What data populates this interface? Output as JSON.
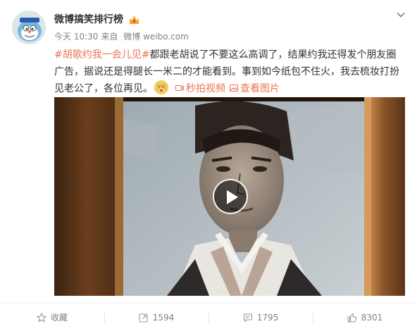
{
  "post": {
    "username": "微博搞笑排行榜",
    "time": "今天 10:30",
    "source_prefix": "来自",
    "source": "微博 weibo.com",
    "hashtag": "#胡歌约我一会儿见#",
    "text": "都跟老胡说了不要这么高调了，结果约我还得发个朋友圈广告，据说还是得腿长一米二的才能看到。事到如今纸包不住火，我去梳妆打扮见老公了，各位再见。",
    "links": {
      "video": "秒拍视频",
      "image": "查看图片"
    }
  },
  "actions": {
    "favorite": "收藏",
    "repost": "1594",
    "comment": "1795",
    "like": "8301"
  },
  "colors": {
    "accent": "#eb7350",
    "meta_gray": "#808080",
    "text": "#333333"
  },
  "icons": [
    "avatar",
    "vip-badge-icon",
    "chevron-down-icon",
    "emoji-icon",
    "video-icon",
    "image-icon",
    "play-icon",
    "star-icon",
    "repost-icon",
    "comment-icon",
    "like-icon"
  ]
}
